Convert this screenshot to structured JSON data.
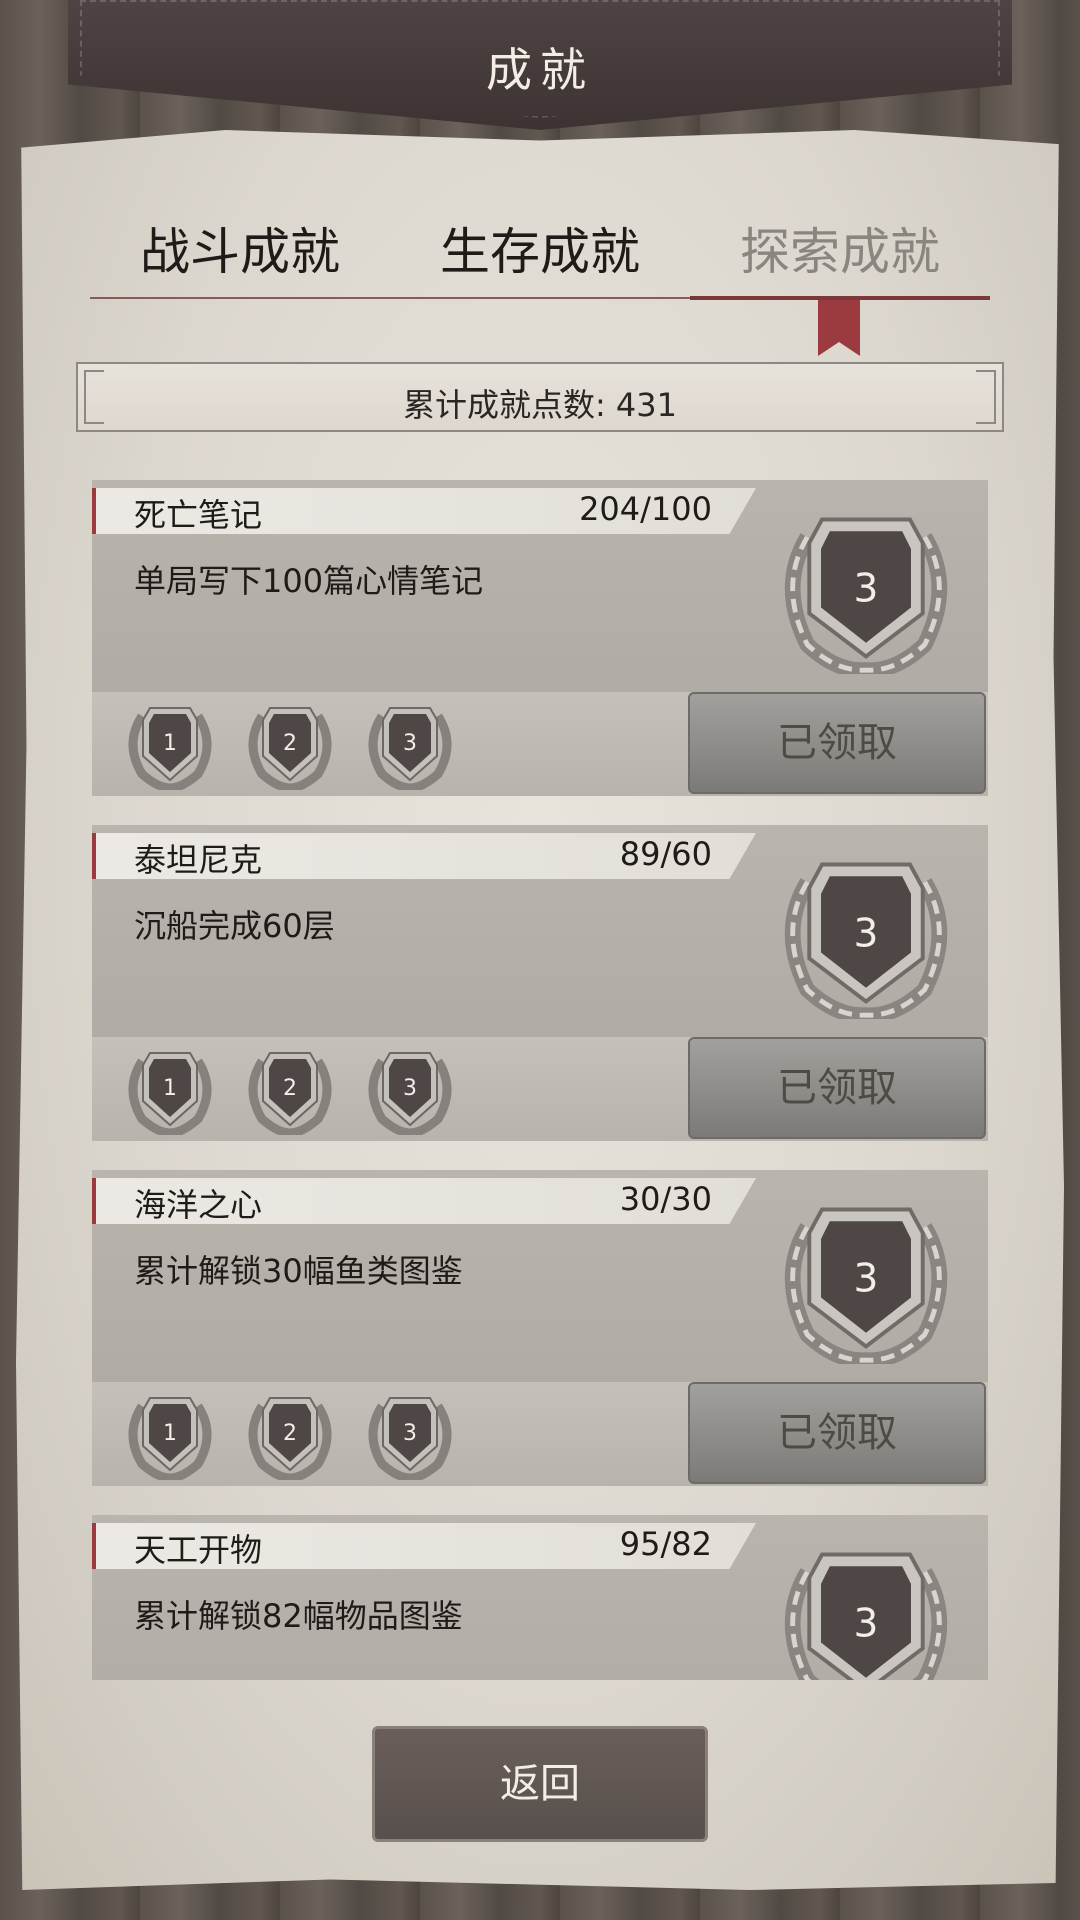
{
  "header": {
    "title": "成就"
  },
  "tabs": [
    {
      "label": "战斗成就"
    },
    {
      "label": "生存成就"
    },
    {
      "label": "探索成就",
      "active": true
    }
  ],
  "points": {
    "text": "累计成就点数: 431"
  },
  "achievements": [
    {
      "name": "死亡笔记",
      "progress": "204/100",
      "desc": "单局写下100篇心情笔记",
      "level": "3",
      "tiers": [
        "1",
        "2",
        "3"
      ],
      "button": "已领取"
    },
    {
      "name": "泰坦尼克",
      "progress": "89/60",
      "desc": "沉船完成60层",
      "level": "3",
      "tiers": [
        "1",
        "2",
        "3"
      ],
      "button": "已领取"
    },
    {
      "name": "海洋之心",
      "progress": "30/30",
      "desc": "累计解锁30幅鱼类图鉴",
      "level": "3",
      "tiers": [
        "1",
        "2",
        "3"
      ],
      "button": "已领取"
    },
    {
      "name": "天工开物",
      "progress": "95/82",
      "desc": "累计解锁82幅物品图鉴",
      "level": "3"
    }
  ],
  "footer": {
    "back_label": "返回"
  },
  "colors": {
    "accent": "#9b3a3f",
    "button_dark": "#57504c"
  },
  "icons": [
    "laurel-medal-icon",
    "bookmark-ribbon-icon"
  ]
}
